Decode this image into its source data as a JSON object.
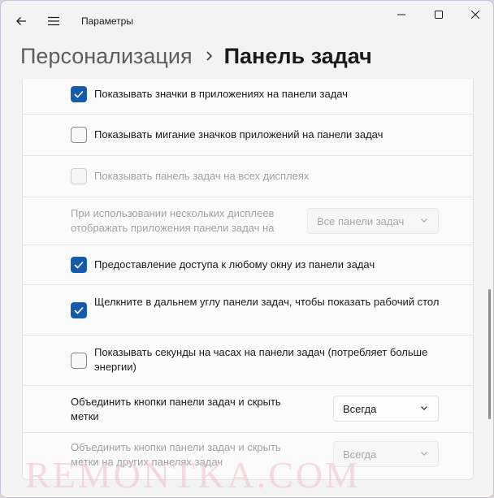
{
  "window": {
    "app_title": "Параметры",
    "back_icon": "back-arrow-icon",
    "menu_icon": "hamburger-menu-icon"
  },
  "breadcrumb": {
    "parent": "Персонализация",
    "current": "Панель задач"
  },
  "settings": [
    {
      "label": "Показывать значки в приложениях на панели задач",
      "checked": true,
      "disabled": false
    },
    {
      "label": "Показывать мигание значков приложений на панели задач",
      "checked": false,
      "disabled": false
    },
    {
      "label": "Показывать панель задач на всех дисплеях",
      "checked": false,
      "disabled": true
    },
    {
      "label": "При использовании нескольких дисплеев отображать приложения панели задач на",
      "dropdown_value": "Все панели задач",
      "disabled": true
    },
    {
      "label": "Предоставление доступа к любому окну из панели задач",
      "checked": true,
      "disabled": false
    },
    {
      "label": "Щелкните в дальнем углу панели задач, чтобы показать рабочий стол",
      "checked": true,
      "disabled": false
    },
    {
      "label": "Показывать секунды на часах на панели задач (потребляет больше энергии)",
      "checked": false,
      "disabled": false
    },
    {
      "label": "Объединить кнопки панели задач и скрыть метки",
      "dropdown_value": "Всегда",
      "disabled": false
    },
    {
      "label": "Объединить кнопки панели задач и скрыть метки на других панелях задач",
      "dropdown_value": "Всегда",
      "disabled": true
    }
  ],
  "watermark": "REMONTKA.COM",
  "colors": {
    "accent": "#165aa9",
    "background": "#f3f3f3",
    "card": "#fbfbfb"
  }
}
